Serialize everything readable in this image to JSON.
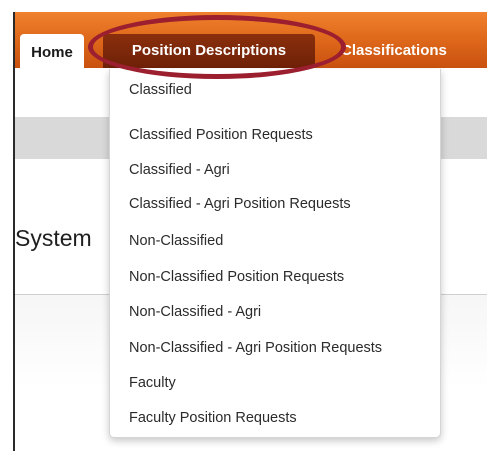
{
  "nav": {
    "tabs": [
      {
        "label": "Home"
      },
      {
        "label": "Position Descriptions"
      },
      {
        "label": "Classifications"
      }
    ]
  },
  "page": {
    "title_fragment": "System"
  },
  "dropdown": {
    "items": [
      "Classified",
      "Classified Position Requests",
      "Classified - Agri",
      "Classified - Agri Position Requests",
      "Non-Classified",
      "Non-Classified Position Requests",
      "Non-Classified - Agri",
      "Non-Classified - Agri Position Requests",
      "Faculty",
      "Faculty Position Requests"
    ]
  },
  "colors": {
    "nav_orange": "#e06a1c",
    "active_tab": "#7a2709",
    "annotation_ring": "#9b1f2e"
  }
}
